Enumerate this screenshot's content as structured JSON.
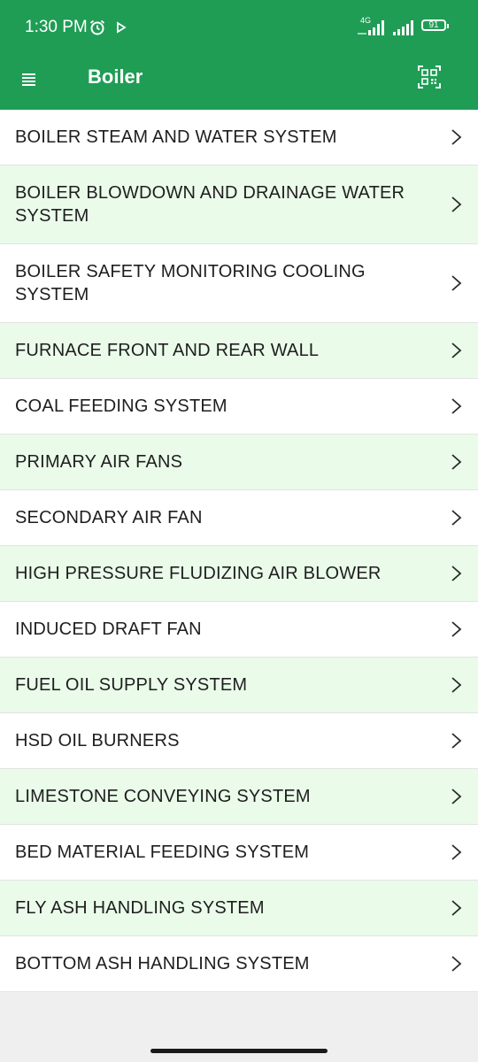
{
  "status_bar": {
    "time": "1:30 PM",
    "network": "4G",
    "battery": "91"
  },
  "toolbar": {
    "title": "Boiler"
  },
  "colors": {
    "primary": "#1f9d55",
    "row_alt": "#eafbea"
  },
  "items": [
    {
      "label": "BOILER STEAM AND WATER SYSTEM",
      "lines": 1,
      "tint": "white"
    },
    {
      "label": "BOILER BLOWDOWN AND DRAINAGE WATER SYSTEM",
      "lines": 2,
      "tint": "green"
    },
    {
      "label": "BOILER SAFETY MONITORING COOLING SYSTEM",
      "lines": 2,
      "tint": "white"
    },
    {
      "label": "FURNACE FRONT AND REAR WALL",
      "lines": 1,
      "tint": "green"
    },
    {
      "label": "COAL FEEDING SYSTEM",
      "lines": 1,
      "tint": "white"
    },
    {
      "label": "PRIMARY AIR FANS",
      "lines": 1,
      "tint": "green"
    },
    {
      "label": "SECONDARY AIR FAN",
      "lines": 1,
      "tint": "white"
    },
    {
      "label": "HIGH PRESSURE FLUDIZING AIR BLOWER",
      "lines": 1,
      "tint": "green"
    },
    {
      "label": "INDUCED DRAFT FAN",
      "lines": 1,
      "tint": "white"
    },
    {
      "label": "FUEL OIL SUPPLY SYSTEM",
      "lines": 1,
      "tint": "green"
    },
    {
      "label": "HSD OIL BURNERS",
      "lines": 1,
      "tint": "white"
    },
    {
      "label": "LIMESTONE CONVEYING SYSTEM",
      "lines": 1,
      "tint": "green"
    },
    {
      "label": "BED MATERIAL FEEDING SYSTEM",
      "lines": 1,
      "tint": "white"
    },
    {
      "label": "FLY ASH HANDLING SYSTEM",
      "lines": 1,
      "tint": "green"
    },
    {
      "label": "BOTTOM ASH HANDLING SYSTEM",
      "lines": 1,
      "tint": "white"
    }
  ]
}
